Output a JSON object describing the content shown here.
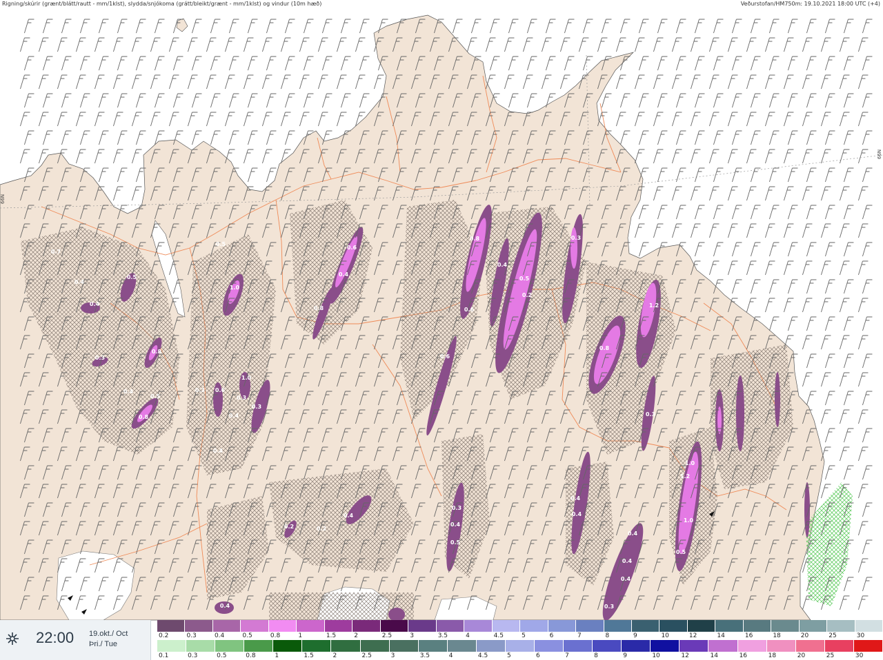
{
  "header": {
    "left": "Rigning/skúrir (grænt/blátt/rautt - mm/1klst), slydda/snjókoma (grátt/bleikt/grænt - mm/1klst) og vindur (10m hæð)",
    "right": "Veðurstofan/HM750m: 19.10.2021 18:00 UTC (+4)"
  },
  "grid_labels": {
    "left": "66N",
    "right": "66N"
  },
  "time_box": {
    "time": "22:00",
    "date": "19.okt./ Oct",
    "day": "Þri./ Tue",
    "icon": "wind-icon"
  },
  "legend_snow": {
    "labels": [
      "0.2",
      "0.3",
      "0.4",
      "0.5",
      "0.8",
      "1",
      "1.5",
      "2",
      "2.5",
      "3",
      "3.5",
      "4",
      "4.5",
      "5",
      "6",
      "7",
      "8",
      "9",
      "10",
      "12",
      "14",
      "16",
      "18",
      "20",
      "25",
      "30"
    ],
    "colors": [
      "#6e4a6e",
      "#8c5a8c",
      "#a866a8",
      "#d37ad3",
      "#f28cf2",
      "#cc66cc",
      "#9e3c9e",
      "#7a2a7a",
      "#4a0a4a",
      "#6a3a8a",
      "#8a5aaa",
      "#a888d8",
      "#b8b8f0",
      "#a0a8e8",
      "#8898d8",
      "#6a80c0",
      "#507898",
      "#3a6070",
      "#2a5060",
      "#204048",
      "#48707a",
      "#587a80",
      "#6a8a8e",
      "#7e9ea2",
      "#a6bec2",
      "#d2dfe2"
    ]
  },
  "legend_rain": {
    "labels": [
      "0.1",
      "0.3",
      "0.5",
      "0.8",
      "1",
      "1.5",
      "2",
      "2.5",
      "3",
      "3.5",
      "4",
      "4.5",
      "5",
      "6",
      "7",
      "8",
      "9",
      "10",
      "12",
      "14",
      "16",
      "18",
      "20",
      "25",
      "30"
    ],
    "colors": [
      "#ccf0cc",
      "#a8dca8",
      "#80c480",
      "#4a9a4a",
      "#0a5a0a",
      "#1e6e2e",
      "#306e40",
      "#3e6e50",
      "#4a7060",
      "#5a8080",
      "#6a8890",
      "#8a9ac8",
      "#a8b0e8",
      "#8a90e0",
      "#6a70d0",
      "#4a4ac0",
      "#2a2aa8",
      "#1010a0",
      "#6a3ab8",
      "#c070d0",
      "#f0a0e0",
      "#f090c0",
      "#f07090",
      "#e84060",
      "#e01818"
    ]
  },
  "precip_labels": [
    {
      "t": "0.5"
    },
    {
      "t": "0.4"
    },
    {
      "t": "0.4"
    },
    {
      "t": "0.8"
    },
    {
      "t": "0.3"
    },
    {
      "t": "0.4"
    },
    {
      "t": "0.5"
    },
    {
      "t": "0.8"
    },
    {
      "t": "0.7"
    },
    {
      "t": "1.0"
    },
    {
      "t": "0.5"
    },
    {
      "t": "0.6"
    },
    {
      "t": "0.3"
    },
    {
      "t": "1.0"
    },
    {
      "t": "0.3"
    },
    {
      "t": "0.4"
    },
    {
      "t": "0.3"
    },
    {
      "t": "0.4"
    },
    {
      "t": "0.6"
    },
    {
      "t": "0.4"
    },
    {
      "t": "0.8"
    },
    {
      "t": "0.8"
    },
    {
      "t": "0.6"
    },
    {
      "t": "0.5"
    },
    {
      "t": "0.2"
    },
    {
      "t": "0.8"
    },
    {
      "t": "1.2"
    },
    {
      "t": "0.3"
    },
    {
      "t": "0.4"
    },
    {
      "t": "0.6"
    },
    {
      "t": "1.0"
    },
    {
      "t": "1.2"
    },
    {
      "t": "1.0"
    },
    {
      "t": "0.5"
    },
    {
      "t": "0.4"
    },
    {
      "t": "0.4"
    },
    {
      "t": "0.5"
    },
    {
      "t": "0.4"
    },
    {
      "t": "0.3"
    },
    {
      "t": "0.4"
    },
    {
      "t": "0.4"
    },
    {
      "t": "0.4"
    },
    {
      "t": "0.4"
    },
    {
      "t": "0.3"
    },
    {
      "t": "0.2"
    },
    {
      "t": "0.2"
    },
    {
      "t": "0.4"
    },
    {
      "t": "0.3"
    }
  ],
  "colors": {
    "land": "#f2e4d6",
    "sea": "#ffffff",
    "roads": "#ef8a57",
    "barbs": "#666666"
  }
}
